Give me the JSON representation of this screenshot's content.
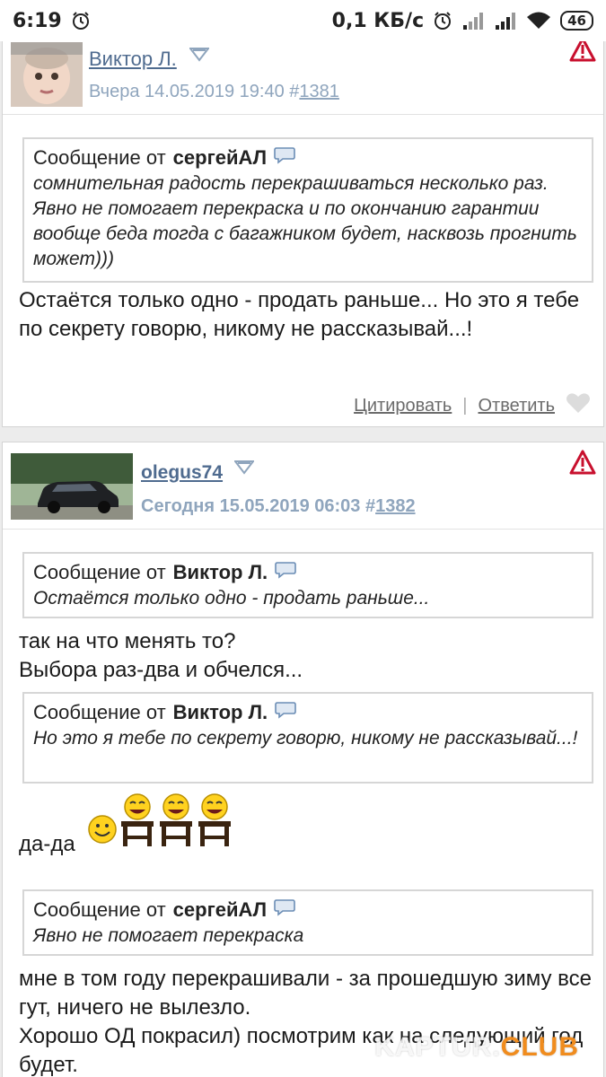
{
  "status_bar": {
    "time": "6:19",
    "speed": "0,1 КБ/с",
    "battery": "46",
    "icons": [
      "alarm-icon",
      "signal-icon",
      "signal-icon",
      "wifi-icon",
      "battery-icon"
    ]
  },
  "posts": [
    {
      "author": "Виктор Л.",
      "date_label": "Вчера 14.05.2019 19:40 #",
      "post_number": "1381",
      "quote": {
        "prefix": "Сообщение от",
        "author": "сергейАЛ",
        "text": "сомнительная радость перекрашиваться несколько раз. Явно не помогает перекраска и по окончанию гарантии вообще беда тогда с багажником будет, насквозь прогнить может)))"
      },
      "message": "Остаётся только одно - продать раньше... Но это я тебе по секрету говорю, никому не рассказывай...!",
      "actions": {
        "quote_label": "Цитировать",
        "reply_label": "Ответить"
      }
    },
    {
      "author": "olegus74",
      "date_label": "Сегодня 15.05.2019 06:03 #",
      "post_number": "1382",
      "quotes": [
        {
          "prefix": "Сообщение от",
          "author": "Виктор Л.",
          "text": "Остаётся только одно - продать раньше..."
        },
        {
          "prefix": "Сообщение от",
          "author": "Виктор Л.",
          "text": "Но это я тебе по секрету говорю, никому не рассказывай...!"
        },
        {
          "prefix": "Сообщение от",
          "author": "сергейАЛ",
          "text": "Явно не помогает перекраска"
        }
      ],
      "messages": [
        "так на что менять то?",
        "Выбора раз-два и обчелся...",
        "да-да",
        "мне в том году перекрашивали - за прошедшую зиму все гут, ничего не вылезло.",
        "Хорошо ОД покрасил) посмотрим как на следующий год будет."
      ]
    }
  ],
  "watermark": {
    "part1": "KAPTUR.",
    "part2": "CLUB"
  },
  "colors": {
    "link": "#4f6b8f",
    "date": "#8fa5bd",
    "warning": "#c8102e",
    "watermark_accent": "#f08c1e"
  }
}
